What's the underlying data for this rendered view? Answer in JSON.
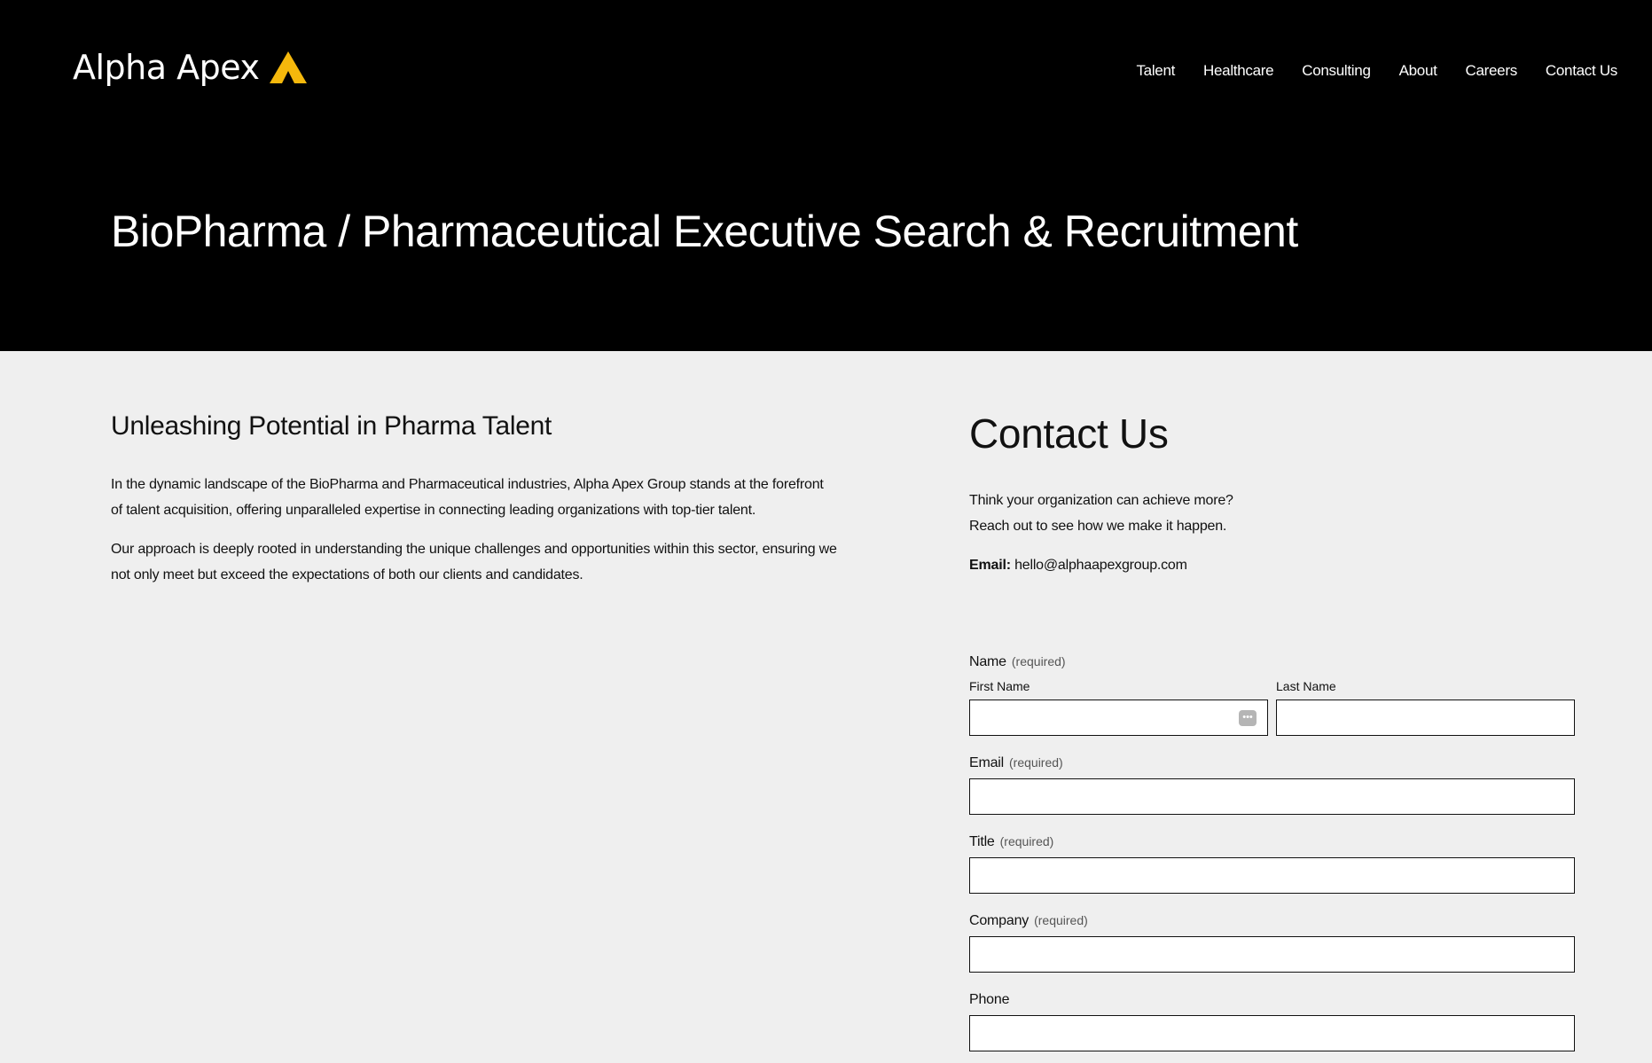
{
  "header": {
    "logo_text": "Alpha Apex",
    "logo_mark_color": "#f5b80c",
    "nav": [
      "Talent",
      "Healthcare",
      "Consulting",
      "About",
      "Careers",
      "Contact Us"
    ]
  },
  "hero": {
    "title": "BioPharma / Pharmaceutical Executive Search & Recruitment"
  },
  "intro": {
    "heading": "Unleashing Potential in Pharma Talent",
    "paragraphs": [
      "In the dynamic landscape of the BioPharma and Pharmaceutical industries, Alpha Apex Group stands at the forefront of talent acquisition, offering unparalleled expertise in connecting leading organizations with top-tier talent.",
      "Our approach is deeply rooted in understanding the unique challenges and opportunities within this sector, ensuring we not only meet but exceed the expectations of both our clients and candidates."
    ]
  },
  "contact": {
    "heading": "Contact Us",
    "line1": "Think your organization can achieve more?",
    "line2": "Reach out to see how we make it happen.",
    "email_label": "Email:",
    "email_value": "hello@alphaapexgroup.com"
  },
  "form": {
    "required_text": "(required)",
    "name_label": "Name",
    "first_name_label": "First Name",
    "last_name_label": "Last Name",
    "email_label": "Email",
    "title_label": "Title",
    "company_label": "Company",
    "phone_label": "Phone"
  }
}
